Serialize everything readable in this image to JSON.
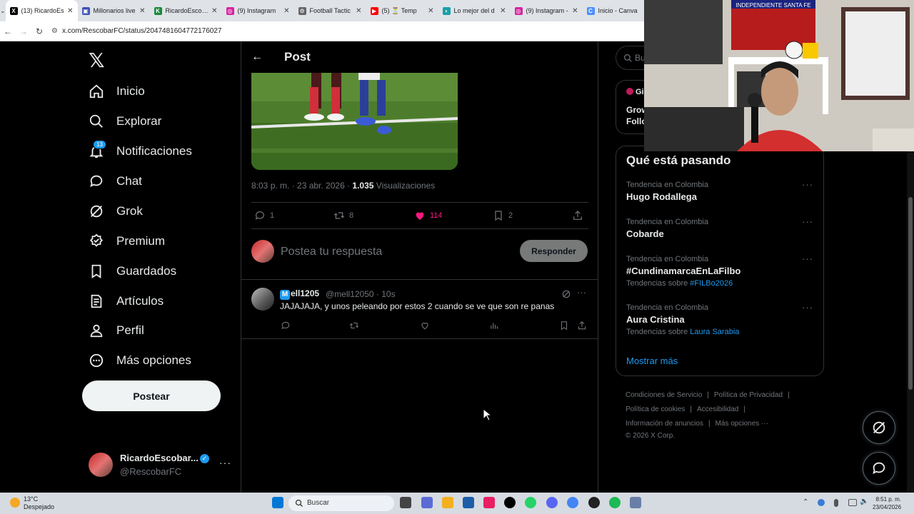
{
  "browser": {
    "tabs": [
      {
        "title": "(13) RicardoEs",
        "color": "#000000",
        "glyph": "X",
        "active": true
      },
      {
        "title": "Millonarios live",
        "color": "#3f51b5",
        "glyph": "▣",
        "active": false
      },
      {
        "title": "RicardoEscobar",
        "color": "#1a8a3a",
        "glyph": "K",
        "active": false
      },
      {
        "title": "(9) Instagram",
        "color": "#d6249f",
        "glyph": "◎",
        "active": false
      },
      {
        "title": "Football Tactic",
        "color": "#666666",
        "glyph": "⚙",
        "active": false
      },
      {
        "title": "(5) ⏳ Temp",
        "color": "#ff0000",
        "glyph": "▶",
        "active": false
      },
      {
        "title": "Lo mejor del d",
        "color": "#19a0a8",
        "glyph": "◗",
        "active": false
      },
      {
        "title": "(9) Instagram -",
        "color": "#d6249f",
        "glyph": "◎",
        "active": false
      },
      {
        "title": "Inicio - Canva",
        "color": "#4d8eff",
        "glyph": "C",
        "active": false
      }
    ],
    "url": "x.com/RescobarFC/status/2047481604772176027"
  },
  "nav": {
    "items": [
      {
        "label": "Inicio",
        "icon": "home-icon"
      },
      {
        "label": "Explorar",
        "icon": "search-icon"
      },
      {
        "label": "Notificaciones",
        "icon": "bell-icon"
      },
      {
        "label": "Chat",
        "icon": "chat-icon"
      },
      {
        "label": "Grok",
        "icon": "grok-icon"
      },
      {
        "label": "Premium",
        "icon": "premium-icon"
      },
      {
        "label": "Guardados",
        "icon": "bookmark-icon"
      },
      {
        "label": "Artículos",
        "icon": "article-icon"
      },
      {
        "label": "Perfil",
        "icon": "person-icon"
      },
      {
        "label": "Más opciones",
        "icon": "more-circle-icon"
      }
    ],
    "notif_badge": "13",
    "post_button": "Postear",
    "account": {
      "name": "RicardoEscobar...",
      "handle": "@RescobarFC"
    }
  },
  "post": {
    "header_title": "Post",
    "time": "8:03 p. m. · 23 abr. 2026 · ",
    "views_count": "1.035",
    "views_label": " Visualizaciones",
    "stats": {
      "replies": "1",
      "reposts": "8",
      "likes": "114",
      "bookmarks": "2"
    },
    "like_color": "#f91880"
  },
  "reply_box": {
    "placeholder": "Postea tu respuesta",
    "button": "Responder"
  },
  "reply": {
    "badge": "M",
    "name": "ell1205",
    "handle": "@mell12050 · 10s",
    "text": "JAJAJAJA, y unos peleando por estos 2 cuando se ve que son re panas"
  },
  "sidebar": {
    "search_placeholder": "Bu",
    "grok_card_head": "Gi",
    "grok_card_line1": "Grow",
    "grok_card_line2": "Follo",
    "trending_title": "Qué está pasando",
    "trends": [
      {
        "context": "Tendencia en Colombia",
        "name": "Hugo Rodallega",
        "sub": "",
        "tag": ""
      },
      {
        "context": "Tendencia en Colombia",
        "name": "Cobarde",
        "sub": "",
        "tag": ""
      },
      {
        "context": "Tendencia en Colombia",
        "name": "#CundinamarcaEnLaFilbo",
        "sub": "Tendencias sobre ",
        "tag": "#FILBo2026"
      },
      {
        "context": "Tendencia en Colombia",
        "name": "Aura Cristina",
        "sub": "Tendencias sobre ",
        "tag": "Laura Sarabia"
      }
    ],
    "show_more": "Mostrar más",
    "footer": {
      "l1a": "Condiciones de Servicio",
      "l1b": "Política de Privacidad",
      "l2a": "Política de cookies",
      "l2b": "Accesibilidad",
      "l3a": "Información de anuncios",
      "l3b": "Más opciones ···",
      "copyright": "© 2026 X Corp."
    }
  },
  "webcam": {
    "banner": "INDEPENDIENTE SANTA FE"
  },
  "taskbar": {
    "temp": "13°C",
    "weather": "Despejado",
    "search": "Buscar",
    "time": "8:51 p. m.",
    "date": "23/04/2026"
  }
}
